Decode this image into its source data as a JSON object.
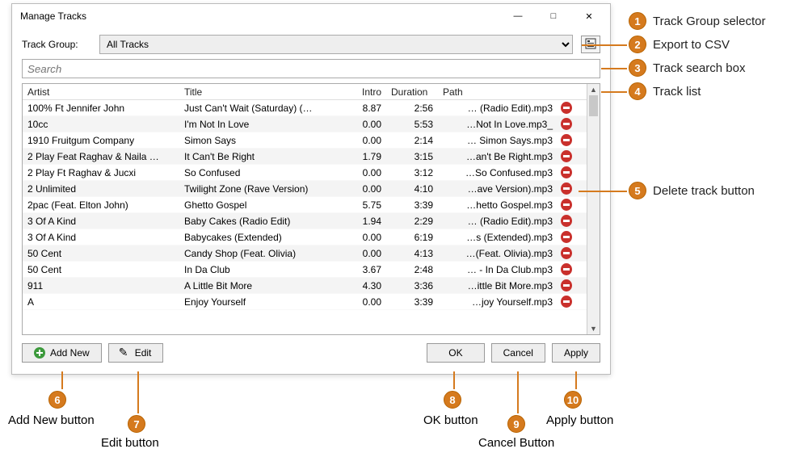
{
  "window": {
    "title": "Manage Tracks"
  },
  "top": {
    "group_label": "Track Group:",
    "group_selected": "All Tracks",
    "search_placeholder": "Search"
  },
  "columns": {
    "artist": "Artist",
    "title": "Title",
    "intro": "Intro",
    "duration": "Duration",
    "path": "Path"
  },
  "tracks": [
    {
      "artist": "100% Ft Jennifer John",
      "title": "Just Can't Wait (Saturday) (…",
      "intro": "8.87",
      "duration": "2:56",
      "path": "… (Radio Edit).mp3"
    },
    {
      "artist": "10cc",
      "title": "I'm Not In Love",
      "intro": "0.00",
      "duration": "5:53",
      "path": "…Not In Love.mp3_"
    },
    {
      "artist": "1910 Fruitgum Company",
      "title": "Simon Says",
      "intro": "0.00",
      "duration": "2:14",
      "path": "… Simon Says.mp3"
    },
    {
      "artist": "2 Play Feat Raghav & Naila …",
      "title": "It Can't Be Right",
      "intro": "1.79",
      "duration": "3:15",
      "path": "…an't Be Right.mp3"
    },
    {
      "artist": "2 Play Ft Raghav & Jucxi",
      "title": "So Confused",
      "intro": "0.00",
      "duration": "3:12",
      "path": "…So Confused.mp3"
    },
    {
      "artist": "2 Unlimited",
      "title": "Twilight Zone (Rave Version)",
      "intro": "0.00",
      "duration": "4:10",
      "path": "…ave Version).mp3"
    },
    {
      "artist": "2pac (Feat. Elton John)",
      "title": "Ghetto Gospel",
      "intro": "5.75",
      "duration": "3:39",
      "path": "…hetto Gospel.mp3"
    },
    {
      "artist": "3 Of A Kind",
      "title": "Baby Cakes (Radio Edit)",
      "intro": "1.94",
      "duration": "2:29",
      "path": "… (Radio Edit).mp3"
    },
    {
      "artist": "3 Of A Kind",
      "title": "Babycakes (Extended)",
      "intro": "0.00",
      "duration": "6:19",
      "path": "…s (Extended).mp3"
    },
    {
      "artist": "50 Cent",
      "title": "Candy Shop (Feat. Olivia)",
      "intro": "0.00",
      "duration": "4:13",
      "path": "…(Feat. Olivia).mp3"
    },
    {
      "artist": "50 Cent",
      "title": "In Da Club",
      "intro": "3.67",
      "duration": "2:48",
      "path": "… - In Da Club.mp3"
    },
    {
      "artist": "911",
      "title": "A Little Bit More",
      "intro": "4.30",
      "duration": "3:36",
      "path": "…ittle Bit More.mp3"
    },
    {
      "artist": "A",
      "title": "Enjoy Yourself",
      "intro": "0.00",
      "duration": "3:39",
      "path": "…joy Yourself.mp3"
    }
  ],
  "footer": {
    "add_new": "Add New",
    "edit": "Edit",
    "ok": "OK",
    "cancel": "Cancel",
    "apply": "Apply"
  },
  "callouts": {
    "c1": "Track Group selector",
    "c2": "Export to CSV",
    "c3": "Track search box",
    "c4": "Track list",
    "c5": "Delete track button",
    "c6": "Add New button",
    "c7": "Edit button",
    "c8": "OK button",
    "c9": "Cancel Button",
    "c10": "Apply button"
  }
}
